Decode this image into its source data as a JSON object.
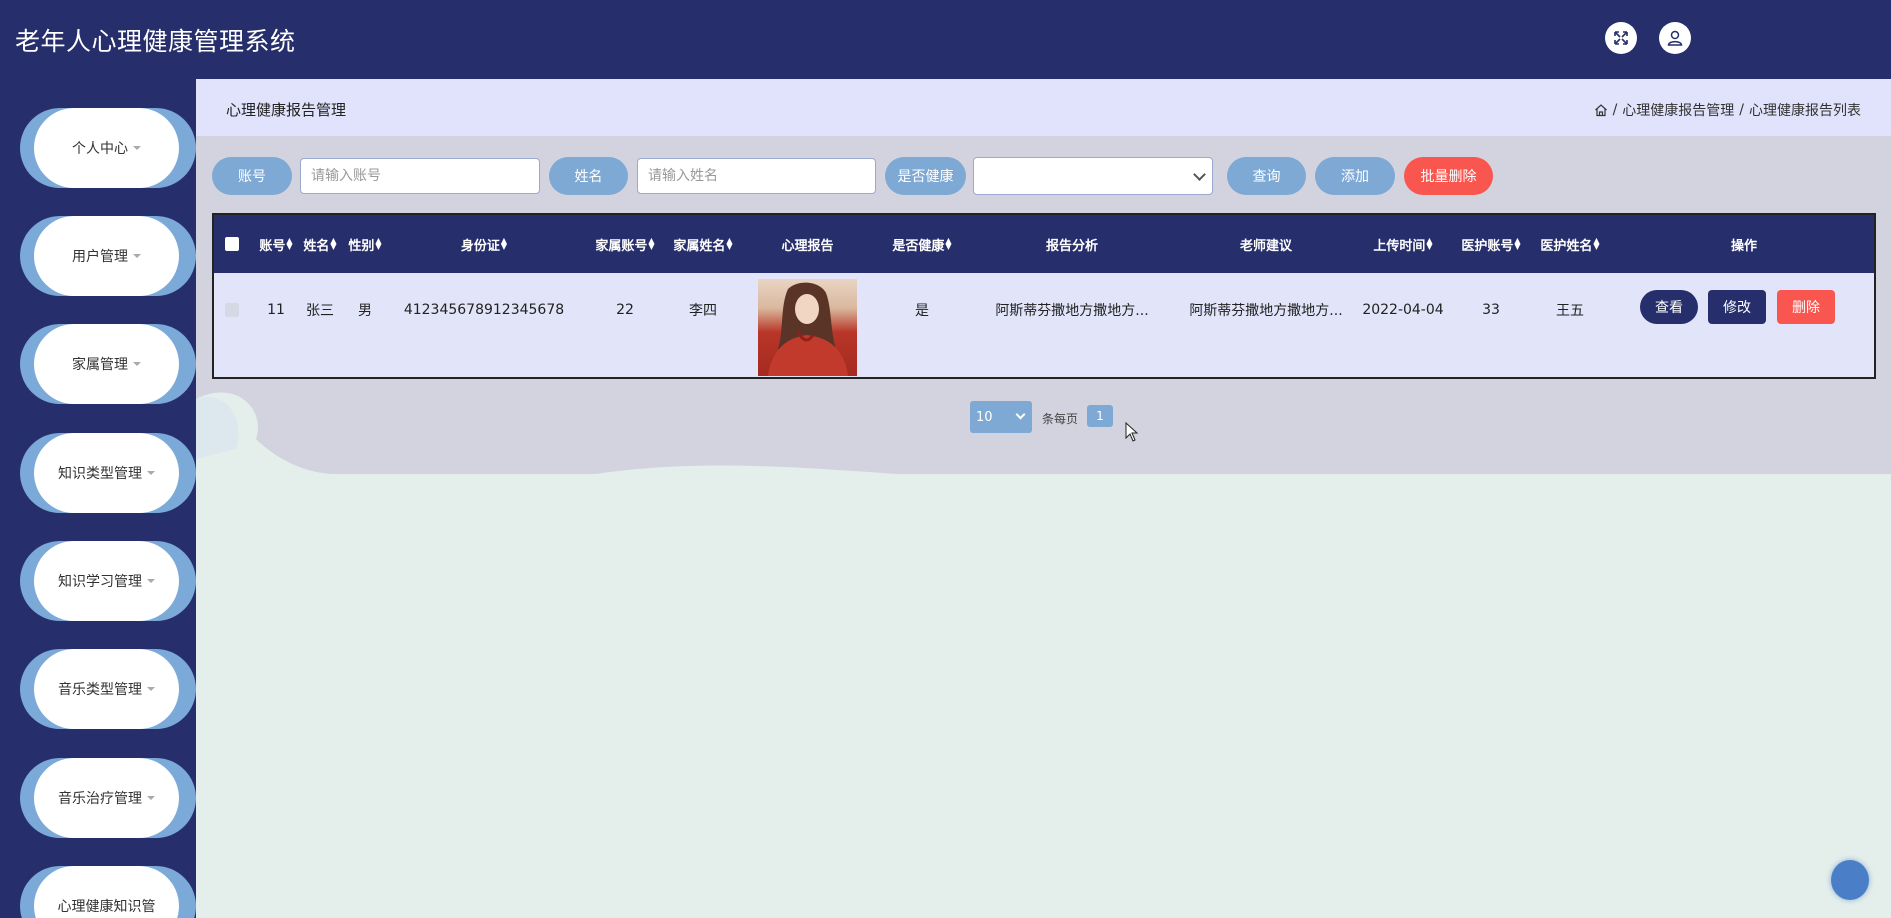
{
  "app": {
    "title": "老年人心理健康管理系统"
  },
  "header": {
    "fullscreen_icon": "fullscreen-icon",
    "user_icon": "user-icon"
  },
  "sidebar": {
    "items": [
      {
        "label": "个人中心"
      },
      {
        "label": "用户管理"
      },
      {
        "label": "家属管理"
      },
      {
        "label": "知识类型管理"
      },
      {
        "label": "知识学习管理"
      },
      {
        "label": "音乐类型管理"
      },
      {
        "label": "音乐治疗管理"
      },
      {
        "label": "心理健康知识管"
      }
    ]
  },
  "page": {
    "title": "心理健康报告管理",
    "breadcrumb": {
      "home_icon": "home-icon",
      "items": [
        "心理健康报告管理",
        "心理健康报告列表"
      ],
      "separator": "/"
    }
  },
  "search": {
    "account_label": "账号",
    "account_placeholder": "请输入账号",
    "name_label": "姓名",
    "name_placeholder": "请输入姓名",
    "healthy_label": "是否健康",
    "healthy_value": "",
    "query_button": "查询",
    "add_button": "添加",
    "batch_delete_button": "批量删除"
  },
  "table": {
    "columns": [
      "账号",
      "姓名",
      "性别",
      "身份证",
      "家属账号",
      "家属姓名",
      "心理报告",
      "是否健康",
      "报告分析",
      "老师建议",
      "上传时间",
      "医护账号",
      "医护姓名",
      "操作"
    ],
    "rows": [
      {
        "account": "11",
        "name": "张三",
        "gender": "男",
        "id_card": "412345678912345678",
        "family_account": "22",
        "family_name": "李四",
        "report_image": "portrait-image",
        "healthy": "是",
        "analysis": "阿斯蒂芬撒地方撒地方...",
        "advice": "阿斯蒂芬撒地方撒地方...",
        "upload_time": "2022-04-04",
        "medical_account": "33",
        "medical_name": "王五",
        "actions": {
          "view": "查看",
          "edit": "修改",
          "delete": "删除"
        }
      }
    ]
  },
  "pagination": {
    "page_size": "10",
    "per_page_label": "条每页",
    "current_page": "1"
  },
  "colors": {
    "navy": "#262e6b",
    "light_blue": "#7ea9d5",
    "red": "#f9564f",
    "crumb_bg": "#e0e3fb",
    "row_bg": "#e2e4fa"
  }
}
